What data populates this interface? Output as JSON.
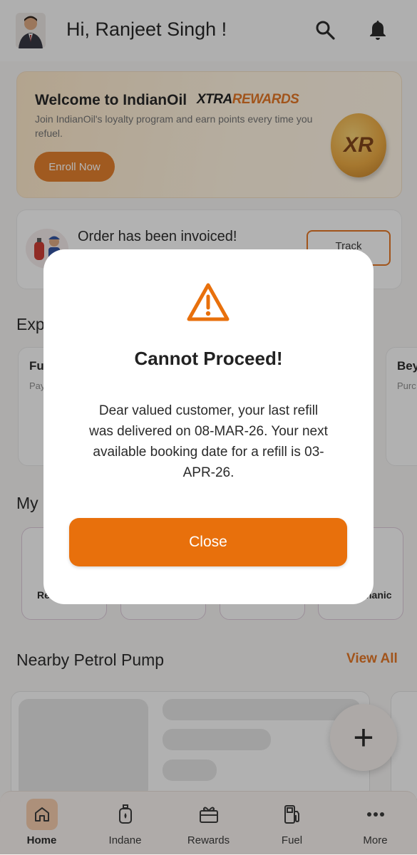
{
  "header": {
    "greeting": "Hi, Ranjeet Singh !",
    "avatar_icon": "user-avatar",
    "search_icon": "search-icon",
    "bell_icon": "bell-icon"
  },
  "welcome": {
    "title": "Welcome to IndianOil",
    "brand_x": "XTRA",
    "brand_rewards": "REWARDS",
    "subtitle": "Join IndianOil's loyalty program and earn points every time you refuel.",
    "enroll_label": "Enroll Now",
    "coin_text": "XR"
  },
  "order": {
    "status": "Order has been invoiced!",
    "track_label": "Track"
  },
  "explore": {
    "title": "Exp",
    "cards": [
      {
        "title": "Fu",
        "sub": "Pay"
      },
      {
        "title": "Bey",
        "sub": "Purc"
      }
    ]
  },
  "my_section": {
    "title": "My",
    "services": [
      {
        "label": "Re"
      },
      {
        "label": ""
      },
      {
        "label": ""
      },
      {
        "label": "hanic"
      }
    ]
  },
  "nearby": {
    "title": "Nearby Petrol Pump",
    "view_all": "View All"
  },
  "fab": {
    "label": "+"
  },
  "nav": {
    "items": [
      {
        "label": "Home",
        "icon": "home-icon",
        "active": true
      },
      {
        "label": "Indane",
        "icon": "cylinder-icon",
        "active": false
      },
      {
        "label": "Rewards",
        "icon": "gift-icon",
        "active": false
      },
      {
        "label": "Fuel",
        "icon": "fuel-pump-icon",
        "active": false
      },
      {
        "label": "More",
        "icon": "more-dots-icon",
        "active": false
      }
    ]
  },
  "modal": {
    "icon": "warning-icon",
    "title": "Cannot Proceed!",
    "body": "Dear valued customer, your last refill was delivered on 08-MAR-26. Your next available booking date for a refill is 03-APR-26.",
    "close_label": "Close"
  },
  "colors": {
    "accent": "#e8700c",
    "scrim": "rgba(25,25,25,0.32)"
  }
}
